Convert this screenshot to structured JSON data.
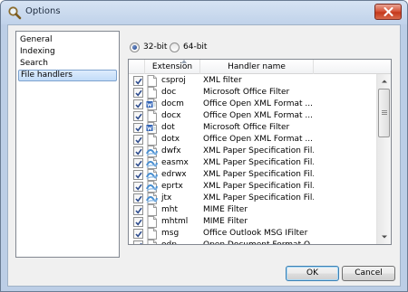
{
  "window": {
    "title": "Options"
  },
  "nav": {
    "items": [
      {
        "label": "General",
        "selected": false
      },
      {
        "label": "Indexing",
        "selected": false
      },
      {
        "label": "Search",
        "selected": false
      },
      {
        "label": "File handlers",
        "selected": true
      }
    ]
  },
  "arch": {
    "options": [
      {
        "label": "32-bit",
        "checked": true
      },
      {
        "label": "64-bit",
        "checked": false
      }
    ]
  },
  "table": {
    "columns": [
      "Extension",
      "Handler name"
    ],
    "rows": [
      {
        "ext": "csproj",
        "handler": "XML filter",
        "icon": "blank-file-icon",
        "checked": true
      },
      {
        "ext": "doc",
        "handler": "Microsoft Office Filter",
        "icon": "blank-file-icon",
        "checked": true
      },
      {
        "ext": "docm",
        "handler": "Office Open XML Format ...",
        "icon": "word-file-icon",
        "checked": true
      },
      {
        "ext": "docx",
        "handler": "Office Open XML Format ...",
        "icon": "blank-file-icon",
        "checked": true
      },
      {
        "ext": "dot",
        "handler": "Microsoft Office Filter",
        "icon": "word-file-icon",
        "checked": true
      },
      {
        "ext": "dotx",
        "handler": "Office Open XML Format ...",
        "icon": "blank-file-icon",
        "checked": true
      },
      {
        "ext": "dwfx",
        "handler": "XML Paper Specification Fil...",
        "icon": "xps-file-icon",
        "checked": true
      },
      {
        "ext": "easmx",
        "handler": "XML Paper Specification Fil...",
        "icon": "xps-file-icon",
        "checked": true
      },
      {
        "ext": "edrwx",
        "handler": "XML Paper Specification Fil...",
        "icon": "xps-file-icon",
        "checked": true
      },
      {
        "ext": "eprtx",
        "handler": "XML Paper Specification Fil...",
        "icon": "xps-file-icon",
        "checked": true
      },
      {
        "ext": "jtx",
        "handler": "XML Paper Specification Fil...",
        "icon": "xps-file-icon",
        "checked": true
      },
      {
        "ext": "mht",
        "handler": "MIME Filter",
        "icon": "blank-file-icon",
        "checked": true
      },
      {
        "ext": "mhtml",
        "handler": "MIME Filter",
        "icon": "blank-file-icon",
        "checked": true
      },
      {
        "ext": "msg",
        "handler": "Office Outlook MSG IFilter",
        "icon": "blank-file-icon",
        "checked": true
      },
      {
        "ext": "odp",
        "handler": "Open Document Format O...",
        "icon": "odp-file-icon",
        "checked": true
      }
    ]
  },
  "buttons": {
    "ok": "OK",
    "cancel": "Cancel"
  },
  "icons": {
    "app": "magnifier-icon",
    "close": "close-icon",
    "sort": "sort-ascending-icon",
    "scroll_up": "scroll-up-arrow-icon",
    "scroll_down": "scroll-down-arrow-icon",
    "check": "checkmark-icon"
  },
  "colors": {
    "accent": "#3c7fb1",
    "selection": "#c2dcf8",
    "close": "#c4391c",
    "word_blue": "#2b5fb4",
    "xps_blue": "#4a8fd0"
  }
}
